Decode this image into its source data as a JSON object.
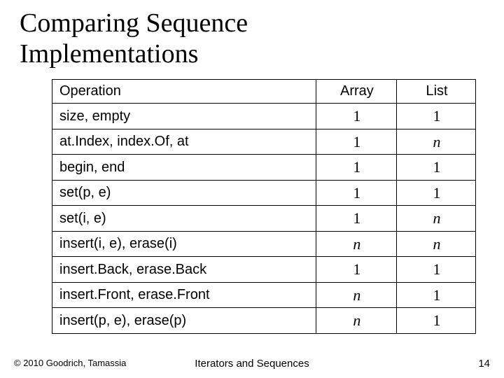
{
  "title_line1": "Comparing Sequence",
  "title_line2": "Implementations",
  "headers": {
    "operation": "Operation",
    "array": "Array",
    "list": "List"
  },
  "rows": [
    {
      "op": "size, empty",
      "array": "1",
      "list": "1",
      "array_ital": false,
      "list_ital": false
    },
    {
      "op": "at.Index, index.Of, at",
      "array": "1",
      "list": "n",
      "array_ital": false,
      "list_ital": true
    },
    {
      "op": "begin, end",
      "array": "1",
      "list": "1",
      "array_ital": false,
      "list_ital": false
    },
    {
      "op": "set(p, e)",
      "array": "1",
      "list": "1",
      "array_ital": false,
      "list_ital": false
    },
    {
      "op": "set(i, e)",
      "array": "1",
      "list": "n",
      "array_ital": false,
      "list_ital": true
    },
    {
      "op": "insert(i, e), erase(i)",
      "array": "n",
      "list": "n",
      "array_ital": true,
      "list_ital": true
    },
    {
      "op": "insert.Back, erase.Back",
      "array": "1",
      "list": "1",
      "array_ital": false,
      "list_ital": false
    },
    {
      "op": "insert.Front, erase.Front",
      "array": "n",
      "list": "1",
      "array_ital": true,
      "list_ital": false
    },
    {
      "op": "insert(p, e), erase(p)",
      "array": "n",
      "list": "1",
      "array_ital": true,
      "list_ital": false
    }
  ],
  "footer": {
    "copyright": "© 2010 Goodrich, Tamassia",
    "center": "Iterators and Sequences",
    "page": "14"
  },
  "chart_data": {
    "type": "table",
    "title": "Comparing Sequence Implementations",
    "columns": [
      "Operation",
      "Array",
      "List"
    ],
    "rows": [
      [
        "size, empty",
        "1",
        "1"
      ],
      [
        "at.Index, index.Of, at",
        "1",
        "n"
      ],
      [
        "begin, end",
        "1",
        "1"
      ],
      [
        "set(p, e)",
        "1",
        "1"
      ],
      [
        "set(i, e)",
        "1",
        "n"
      ],
      [
        "insert(i, e), erase(i)",
        "n",
        "n"
      ],
      [
        "insert.Back, erase.Back",
        "1",
        "1"
      ],
      [
        "insert.Front, erase.Front",
        "n",
        "1"
      ],
      [
        "insert(p, e), erase(p)",
        "n",
        "1"
      ]
    ]
  }
}
